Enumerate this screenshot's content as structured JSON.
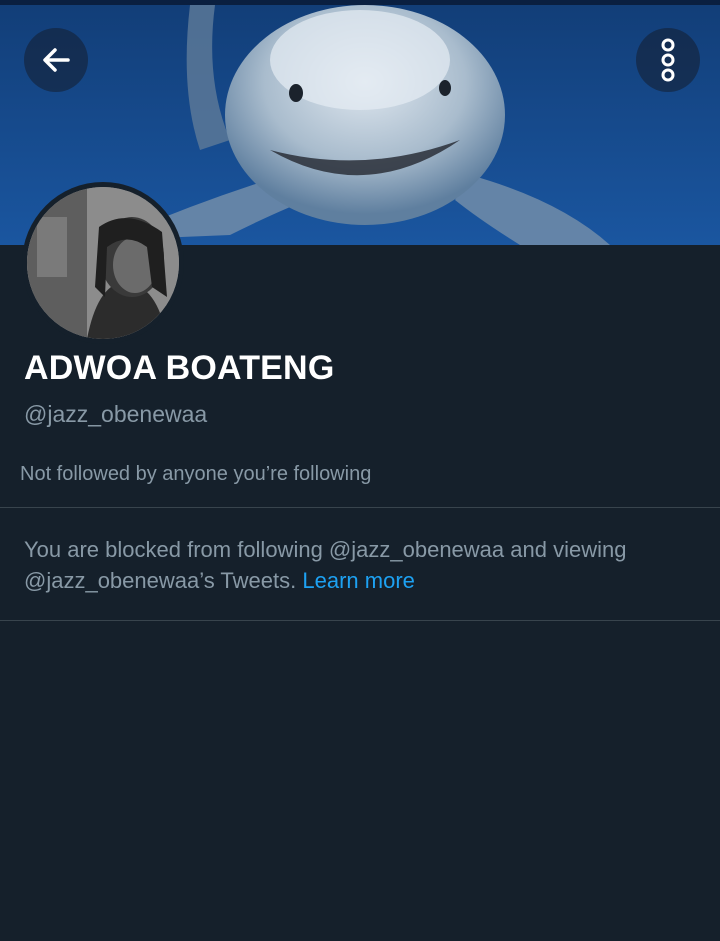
{
  "header": {
    "back_icon": "arrow-left-icon",
    "more_icon": "vertical-dots-icon",
    "banner_colors": {
      "water_dark": "#0d2a52",
      "water_mid": "#134a8a",
      "shark": "#c9d4e0"
    }
  },
  "profile": {
    "name": "ADWOA BOATENG",
    "handle": "@jazz_obenewaa",
    "followers_note": "Not followed by anyone you’re following"
  },
  "blocked": {
    "line1": "You are blocked from following @jazz_obenewaa and viewing",
    "line2": "@jazz_obenewaa’s Tweets.",
    "learn_more": "Learn more"
  },
  "colors": {
    "background": "#15202b",
    "secondary_text": "#8899a6",
    "link": "#1da1f2",
    "divider": "#38444d"
  }
}
